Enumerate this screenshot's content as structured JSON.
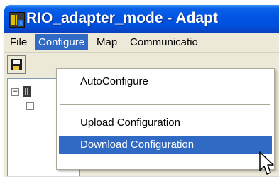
{
  "window": {
    "title": "RIO_adapter_mode - Adapt",
    "app_icon": "app-icon",
    "titlebar_color": "#0054e3"
  },
  "menubar": {
    "items": [
      {
        "label": "File",
        "active": false
      },
      {
        "label": "Configure",
        "active": true
      },
      {
        "label": "Map",
        "active": false
      },
      {
        "label": "Communicatio",
        "active": false
      }
    ]
  },
  "toolbar": {
    "buttons": [
      {
        "icon": "save-icon"
      }
    ]
  },
  "tree": {
    "nodes": [
      {
        "expander": "−",
        "icon": "device-icon"
      }
    ]
  },
  "configure_menu": {
    "items": [
      {
        "label": "AutoConfigure",
        "highlighted": false
      },
      {
        "label": "Upload Configuration",
        "highlighted": false
      },
      {
        "label": "Download Configuration",
        "highlighted": true
      }
    ],
    "highlight_color": "#316ac5"
  }
}
